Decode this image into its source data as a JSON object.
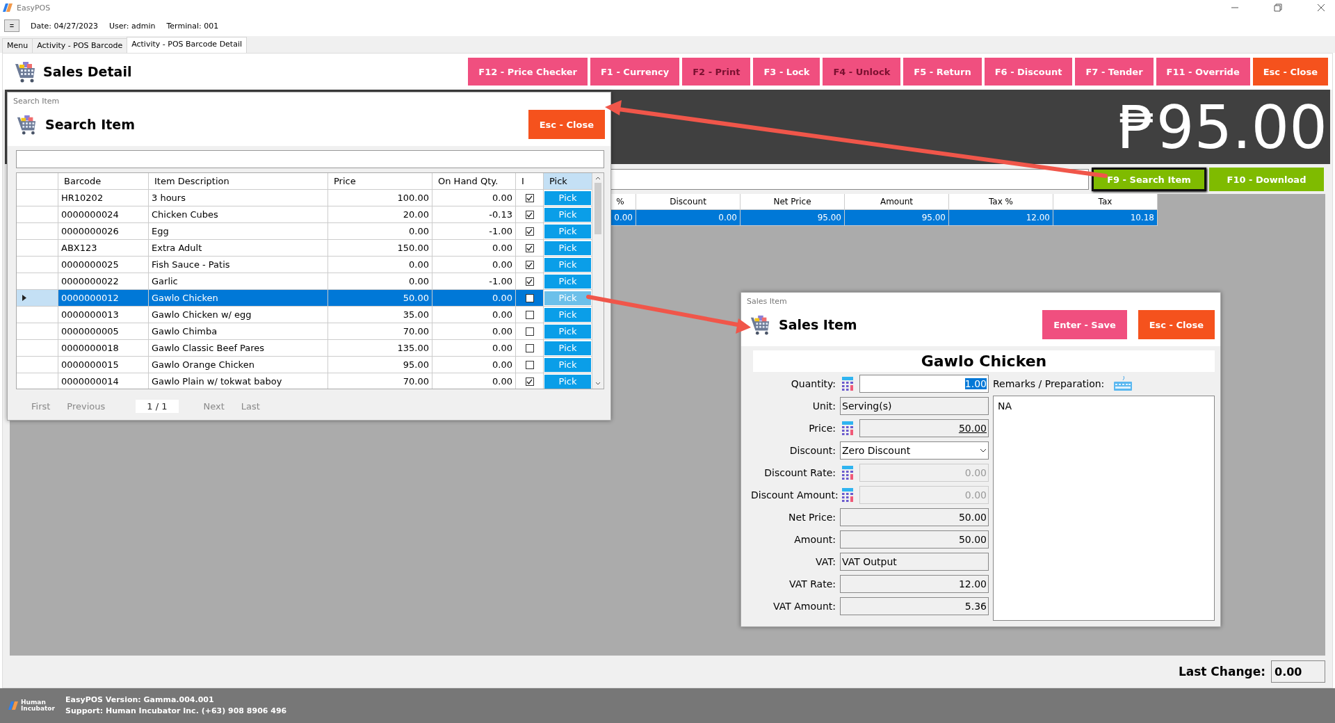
{
  "app": {
    "title": "EasyPOS",
    "menu_button": "=",
    "date": "Date: 04/27/2023",
    "user": "User: admin",
    "terminal": "Terminal: 001"
  },
  "tabs": [
    {
      "label": "Menu",
      "selected": false
    },
    {
      "label": "Activity - POS Barcode",
      "selected": false
    },
    {
      "label": "Activity - POS Barcode Detail",
      "selected": true
    }
  ],
  "header": {
    "title": "Sales Detail",
    "buttons": [
      {
        "label": "F12 - Price Checker",
        "kind": "pink",
        "disabled": false
      },
      {
        "label": "F1 - Currency",
        "kind": "pink",
        "disabled": false
      },
      {
        "label": "F2 - Print",
        "kind": "pink",
        "disabled": true
      },
      {
        "label": "F3 - Lock",
        "kind": "pink",
        "disabled": false
      },
      {
        "label": "F4 - Unlock",
        "kind": "pink",
        "disabled": true
      },
      {
        "label": "F5 - Return",
        "kind": "pink",
        "disabled": false
      },
      {
        "label": "F6 - Discount",
        "kind": "pink",
        "disabled": false
      },
      {
        "label": "F7 - Tender",
        "kind": "pink",
        "disabled": false
      },
      {
        "label": "F11 - Override",
        "kind": "pink",
        "disabled": false
      },
      {
        "label": "Esc - Close",
        "kind": "orange",
        "disabled": false
      }
    ]
  },
  "total": "₱95.00",
  "search_buttons": [
    {
      "label": "F9 - Search Item",
      "focused": true
    },
    {
      "label": "F10 - Download",
      "focused": false
    }
  ],
  "sales_grid": {
    "columns": [
      "%",
      "Discount",
      "Net Price",
      "Amount",
      "Tax %",
      "Tax"
    ],
    "rows": [
      {
        "selected": true,
        "cells": [
          "0.00",
          "0.00",
          "95.00",
          "95.00",
          "12.00",
          "10.18"
        ]
      }
    ]
  },
  "last_change": {
    "label": "Last Change:",
    "value": "0.00"
  },
  "footer": {
    "logo_text": "Human Incubator",
    "version": "EasyPOS Version: Gamma.004.001",
    "support": "Support: Human Incubator Inc. (+63) 908 8906 496"
  },
  "search_dialog": {
    "caption": "Search Item",
    "title": "Search Item",
    "close_button": "Esc - Close",
    "columns": [
      "Barcode",
      "Item Description",
      "Price",
      "On Hand Qty.",
      "I",
      "Pick"
    ],
    "rows": [
      {
        "barcode": "HR10202",
        "description": "3 hours",
        "price": "100.00",
        "on_hand": "0.00",
        "checked": true,
        "pick": "Pick",
        "selected": false
      },
      {
        "barcode": "0000000024",
        "description": "Chicken Cubes",
        "price": "20.00",
        "on_hand": "-0.13",
        "checked": true,
        "pick": "Pick",
        "selected": false
      },
      {
        "barcode": "0000000026",
        "description": "Egg",
        "price": "0.00",
        "on_hand": "-1.00",
        "checked": true,
        "pick": "Pick",
        "selected": false
      },
      {
        "barcode": "ABX123",
        "description": "Extra Adult",
        "price": "150.00",
        "on_hand": "0.00",
        "checked": true,
        "pick": "Pick",
        "selected": false
      },
      {
        "barcode": "0000000025",
        "description": "Fish Sauce - Patis",
        "price": "0.00",
        "on_hand": "0.00",
        "checked": true,
        "pick": "Pick",
        "selected": false
      },
      {
        "barcode": "0000000022",
        "description": "Garlic",
        "price": "0.00",
        "on_hand": "-1.00",
        "checked": true,
        "pick": "Pick",
        "selected": false
      },
      {
        "barcode": "0000000012",
        "description": "Gawlo Chicken",
        "price": "50.00",
        "on_hand": "0.00",
        "checked": false,
        "pick": "Pick",
        "selected": true
      },
      {
        "barcode": "0000000013",
        "description": "Gawlo Chicken w/ egg",
        "price": "35.00",
        "on_hand": "0.00",
        "checked": false,
        "pick": "Pick",
        "selected": false
      },
      {
        "barcode": "0000000005",
        "description": "Gawlo Chimba",
        "price": "70.00",
        "on_hand": "0.00",
        "checked": false,
        "pick": "Pick",
        "selected": false
      },
      {
        "barcode": "0000000018",
        "description": "Gawlo Classic Beef Pares",
        "price": "135.00",
        "on_hand": "0.00",
        "checked": false,
        "pick": "Pick",
        "selected": false
      },
      {
        "barcode": "0000000015",
        "description": "Gawlo Orange Chicken",
        "price": "95.00",
        "on_hand": "0.00",
        "checked": false,
        "pick": "Pick",
        "selected": false
      },
      {
        "barcode": "0000000014",
        "description": "Gawlo Plain w/ tokwat baboy",
        "price": "70.00",
        "on_hand": "0.00",
        "checked": true,
        "pick": "Pick",
        "selected": false
      }
    ],
    "pager": {
      "first": "First",
      "previous": "Previous",
      "page": "1 / 1",
      "next": "Next",
      "last": "Last"
    }
  },
  "sales_item_dialog": {
    "caption": "Sales Item",
    "title": "Sales Item",
    "buttons": [
      {
        "label": "Enter - Save",
        "kind": "pink"
      },
      {
        "label": "Esc - Close",
        "kind": "orange"
      }
    ],
    "item_name": "Gawlo Chicken",
    "fields": [
      {
        "label": "Quantity:",
        "kind": "input",
        "calculator": true,
        "value": "1.00",
        "highlighted": true
      },
      {
        "label": "Unit:",
        "kind": "readonly",
        "calculator": false,
        "value": "Serving(s)"
      },
      {
        "label": "Price:",
        "kind": "readonly",
        "calculator": true,
        "value": "50.00",
        "underline": true
      },
      {
        "label": "Discount:",
        "kind": "select",
        "calculator": false,
        "value": "Zero Discount"
      },
      {
        "label": "Discount Rate:",
        "kind": "disabled",
        "calculator": true,
        "value": "0.00"
      },
      {
        "label": "Discount Amount:",
        "kind": "disabled",
        "calculator": true,
        "value": "0.00"
      },
      {
        "label": "Net Price:",
        "kind": "readonly",
        "calculator": false,
        "value": "50.00"
      },
      {
        "label": "Amount:",
        "kind": "readonly",
        "calculator": false,
        "value": "50.00"
      },
      {
        "label": "VAT:",
        "kind": "readonly",
        "calculator": false,
        "value": "VAT Output"
      },
      {
        "label": "VAT Rate:",
        "kind": "readonly",
        "calculator": false,
        "value": "12.00"
      },
      {
        "label": "VAT Amount:",
        "kind": "readonly",
        "calculator": false,
        "value": "5.36"
      }
    ],
    "remarks_label": "Remarks / Preparation:",
    "remarks": "NA"
  }
}
